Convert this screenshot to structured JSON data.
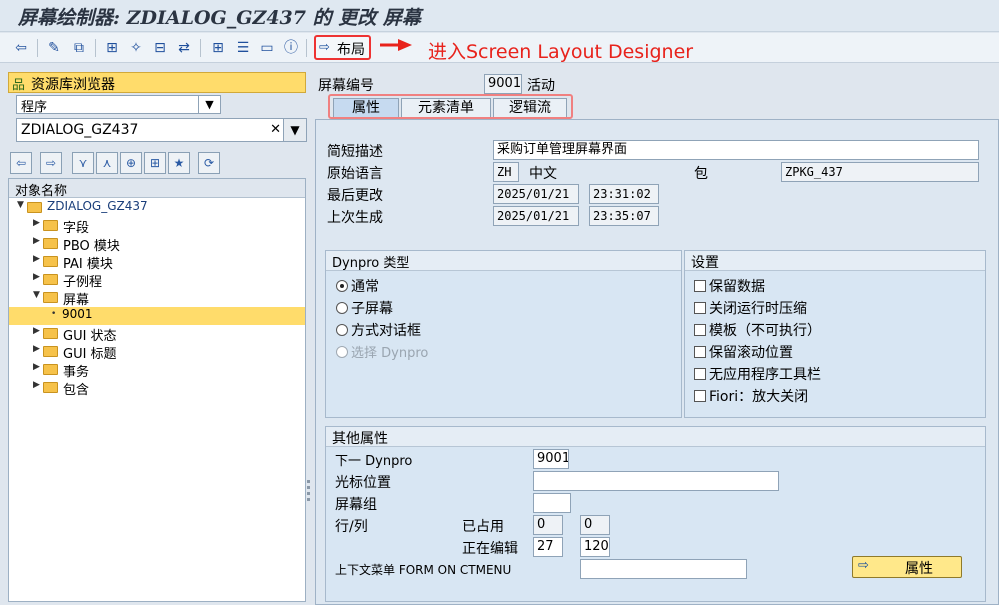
{
  "window": {
    "title": "屏幕绘制器: ZDIALOG_GZ437 的 更改 屏幕"
  },
  "toolbar": {
    "icons": [
      "back-icon",
      "display-change-icon",
      "other-object-icon",
      "hierarchy-icon",
      "magic-wand-icon",
      "where-used-icon",
      "navigate-icon",
      "object-list-icon",
      "indent-icon",
      "screen-layout-icon",
      "info-icon"
    ],
    "layout_button": "布局",
    "annotation": "进入Screen Layout Designer"
  },
  "repository": {
    "header": "资源库浏览器",
    "object_type": "程序",
    "object_name": "ZDIALOG_GZ437",
    "tree_header": "对象名称",
    "root": "ZDIALOG_GZ437",
    "nodes": [
      {
        "label": "字段"
      },
      {
        "label": "PBO 模块"
      },
      {
        "label": "PAI 模块"
      },
      {
        "label": "子例程"
      },
      {
        "label": "屏幕"
      },
      {
        "label": "9001"
      },
      {
        "label": "GUI 状态"
      },
      {
        "label": "GUI 标题"
      },
      {
        "label": "事务"
      },
      {
        "label": "包含"
      }
    ]
  },
  "screen": {
    "number_label": "屏幕编号",
    "number": "9001",
    "status": "活动",
    "tabs": [
      "属性",
      "元素清单",
      "逻辑流"
    ],
    "short_desc_label": "简短描述",
    "short_desc": "采购订单管理屏幕界面",
    "orig_lang_label": "原始语言",
    "orig_lang_code": "ZH",
    "orig_lang_name": "中文",
    "package_label": "包",
    "package": "ZPKG_437",
    "last_changed_label": "最后更改",
    "last_changed_date": "2025/01/21",
    "last_changed_time": "23:31:02",
    "last_gen_label": "上次生成",
    "last_gen_date": "2025/01/21",
    "last_gen_time": "23:35:07"
  },
  "dynpro_type": {
    "title": "Dynpro 类型",
    "options": [
      "通常",
      "子屏幕",
      "方式对话框",
      "选择 Dynpro"
    ],
    "selected": "通常"
  },
  "settings": {
    "title": "设置",
    "options": [
      "保留数据",
      "关闭运行时压缩",
      "模板（不可执行）",
      "保留滚动位置",
      "无应用程序工具栏",
      "Fiori：放大关闭"
    ]
  },
  "other": {
    "title": "其他属性",
    "next_dynpro_label": "下一 Dynpro",
    "next_dynpro": "9001",
    "cursor_label": "光标位置",
    "cursor": "",
    "screen_group_label": "屏幕组",
    "screen_group": "",
    "row_col_label": "行/列",
    "occupied_label": "已占用",
    "occupied_row": "0",
    "occupied_col": "0",
    "editing_label": "正在编辑",
    "editing_row": "27",
    "editing_col": "120",
    "context_menu_label": "上下文菜单 FORM ON CTMENU",
    "context_menu": "",
    "attr_button": "属性"
  }
}
